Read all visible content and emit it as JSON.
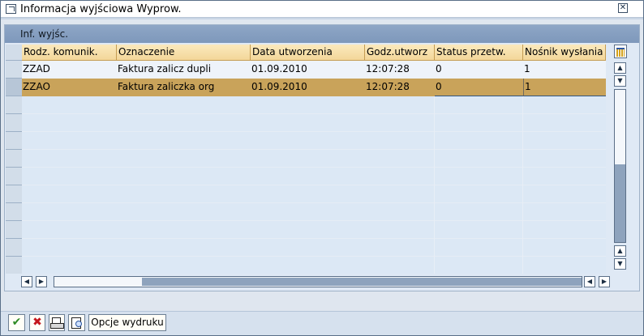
{
  "window": {
    "title": "Informacja wyjściowa Wyprow.",
    "close_glyph": "✕"
  },
  "panel": {
    "header": "Inf. wyjśc."
  },
  "table": {
    "columns": [
      "Rodz. komunik.",
      "Oznaczenie",
      "Data utworzenia",
      "Godz.utworz",
      "Status przetw.",
      "Nośnik wysłania"
    ],
    "rows": [
      [
        "ZZAD",
        "Faktura zalicz dupli",
        "01.09.2010",
        "12:07:28",
        "0",
        "1"
      ],
      [
        "ZZAO",
        "Faktura zaliczka org",
        "01.09.2010",
        "12:07:28",
        "0",
        "1"
      ]
    ],
    "selected_row": 1
  },
  "scroll": {
    "up": "▲",
    "down": "▼",
    "left": "◀",
    "right": "▶"
  },
  "footer": {
    "confirm_glyph": "✔",
    "cancel_glyph": "✖",
    "print_options_label": "Opcje wydruku"
  },
  "icons": {
    "title": "window-icon",
    "config": "table-config-icon",
    "print": "printer-icon",
    "preview": "print-preview-icon"
  }
}
